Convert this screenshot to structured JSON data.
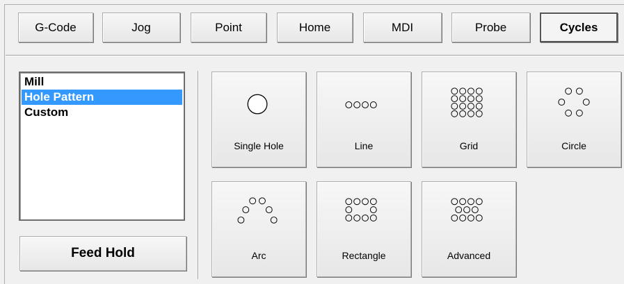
{
  "tabs": [
    {
      "label": "G-Code",
      "active": false
    },
    {
      "label": "Jog",
      "active": false
    },
    {
      "label": "Point",
      "active": false
    },
    {
      "label": "Home",
      "active": false
    },
    {
      "label": "MDI",
      "active": false
    },
    {
      "label": "Probe",
      "active": false
    },
    {
      "label": "Cycles",
      "active": true
    }
  ],
  "list": {
    "items": [
      {
        "label": "Mill",
        "selected": false
      },
      {
        "label": "Hole Pattern",
        "selected": true
      },
      {
        "label": "Custom",
        "selected": false
      }
    ]
  },
  "feed_hold": {
    "label": "Feed Hold"
  },
  "cycles": [
    {
      "label": "Single Hole",
      "icon": "single-hole-icon"
    },
    {
      "label": "Line",
      "icon": "line-pattern-icon"
    },
    {
      "label": "Grid",
      "icon": "grid-pattern-icon"
    },
    {
      "label": "Circle",
      "icon": "circle-pattern-icon"
    },
    {
      "label": "Arc",
      "icon": "arc-pattern-icon"
    },
    {
      "label": "Rectangle",
      "icon": "rectangle-pattern-icon"
    },
    {
      "label": "Advanced",
      "icon": "advanced-pattern-icon"
    }
  ],
  "colors": {
    "selection": "#3399ff",
    "background": "#f0f0f0"
  }
}
